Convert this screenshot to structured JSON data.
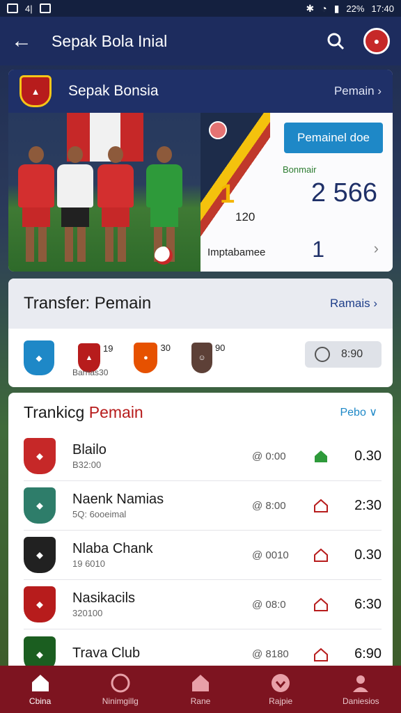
{
  "status_bar": {
    "left_label": "4|",
    "right_label": "22%",
    "time": "17:40"
  },
  "app_bar": {
    "title": "Sepak Bola Inial"
  },
  "featured": {
    "title": "Sepak Bonsia",
    "link": "Pemain",
    "promo_button": "Pemainel doe",
    "green_label": "Bonmair",
    "stat_one": "1",
    "stat_big": "2 566",
    "stat_small": "120",
    "stat_label": "Imptabamee",
    "stat_count": "1",
    "colors": {
      "navy": "#1f3068",
      "gold": "#f4b400",
      "red": "#c0392b",
      "blue_button": "#1e88c7"
    }
  },
  "transfer": {
    "title": "Transfer: Pemain",
    "link": "Ramais",
    "items": [
      {
        "num": ""
      },
      {
        "num": "19"
      },
      {
        "num": "30"
      },
      {
        "num": "90"
      }
    ],
    "sub": "Barnas30",
    "time": "8:90"
  },
  "ranking": {
    "title_prefix": "Trankicg ",
    "title_accent": "Pemain",
    "filter": "Pebo ∨",
    "rows": [
      {
        "name": "Blailo",
        "sub": "B32:00",
        "time": "@ 0:00",
        "score": "0.30",
        "home_color": "#2e9a3a"
      },
      {
        "name": "Naenk Namias",
        "sub": "5Q: 6ooeimal",
        "time": "@ 8:00",
        "score": "2:30",
        "home_color": "#b71c1c"
      },
      {
        "name": "Nlaba Chank",
        "sub": "19 6010",
        "time": "@ 0010",
        "score": "0.30",
        "home_color": "#b71c1c"
      },
      {
        "name": "Nasikacils",
        "sub": "320100",
        "time": "@ 08:0",
        "score": "6:30",
        "home_color": "#b71c1c"
      },
      {
        "name": "Trava Club",
        "sub": "",
        "time": "@ 8180",
        "score": "6:90",
        "home_color": "#b71c1c"
      }
    ]
  },
  "bottom_nav": [
    {
      "label": "Cbina",
      "icon": "home-icon",
      "active": true
    },
    {
      "label": "Ninimgillg",
      "icon": "ball-icon",
      "active": false
    },
    {
      "label": "Rane",
      "icon": "house-icon",
      "active": false
    },
    {
      "label": "Rajpie",
      "icon": "heart-icon",
      "active": false
    },
    {
      "label": "Daniesios",
      "icon": "profile-icon",
      "active": false
    }
  ]
}
